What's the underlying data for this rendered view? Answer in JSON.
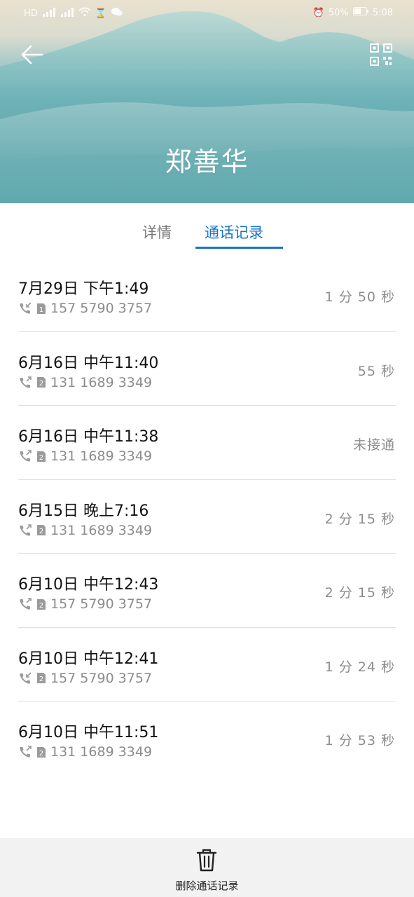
{
  "status_bar": {
    "left_items": [
      "HD",
      "4G",
      "4G",
      "wifi",
      "hourglass",
      "wechat"
    ],
    "battery": "50%",
    "time": "5:08"
  },
  "header": {
    "back_icon": "arrow-left-icon",
    "qr_icon": "qr-code-icon",
    "contact_name": "郑善华"
  },
  "tabs": [
    {
      "label": "详情",
      "active": false
    },
    {
      "label": "通话记录",
      "active": true
    }
  ],
  "calls": [
    {
      "date": "7月29日 下午1:49",
      "number": "157 5790 3757",
      "sim": "1",
      "type": "incoming",
      "duration": "1 分 50 秒"
    },
    {
      "date": "6月16日 中午11:40",
      "number": "131 1689 3349",
      "sim": "2",
      "type": "outgoing",
      "duration": "55 秒"
    },
    {
      "date": "6月16日 中午11:38",
      "number": "131 1689 3349",
      "sim": "2",
      "type": "outgoing",
      "duration": "未接通"
    },
    {
      "date": "6月15日 晚上7:16",
      "number": "131 1689 3349",
      "sim": "2",
      "type": "outgoing",
      "duration": "2 分 15 秒"
    },
    {
      "date": "6月10日 中午12:43",
      "number": "157 5790 3757",
      "sim": "2",
      "type": "outgoing",
      "duration": "2 分 15 秒"
    },
    {
      "date": "6月10日 中午12:41",
      "number": "157 5790 3757",
      "sim": "2",
      "type": "incoming",
      "duration": "1 分 24 秒"
    },
    {
      "date": "6月10日 中午11:51",
      "number": "131 1689 3349",
      "sim": "2",
      "type": "outgoing",
      "duration": "1 分 53 秒"
    }
  ],
  "bottom_action": {
    "icon": "trash-icon",
    "label": "删除通话记录"
  },
  "colors": {
    "accent": "#1a73c8",
    "secondary_text": "#8c8c8c",
    "header_teal": "#5ea9b0"
  }
}
